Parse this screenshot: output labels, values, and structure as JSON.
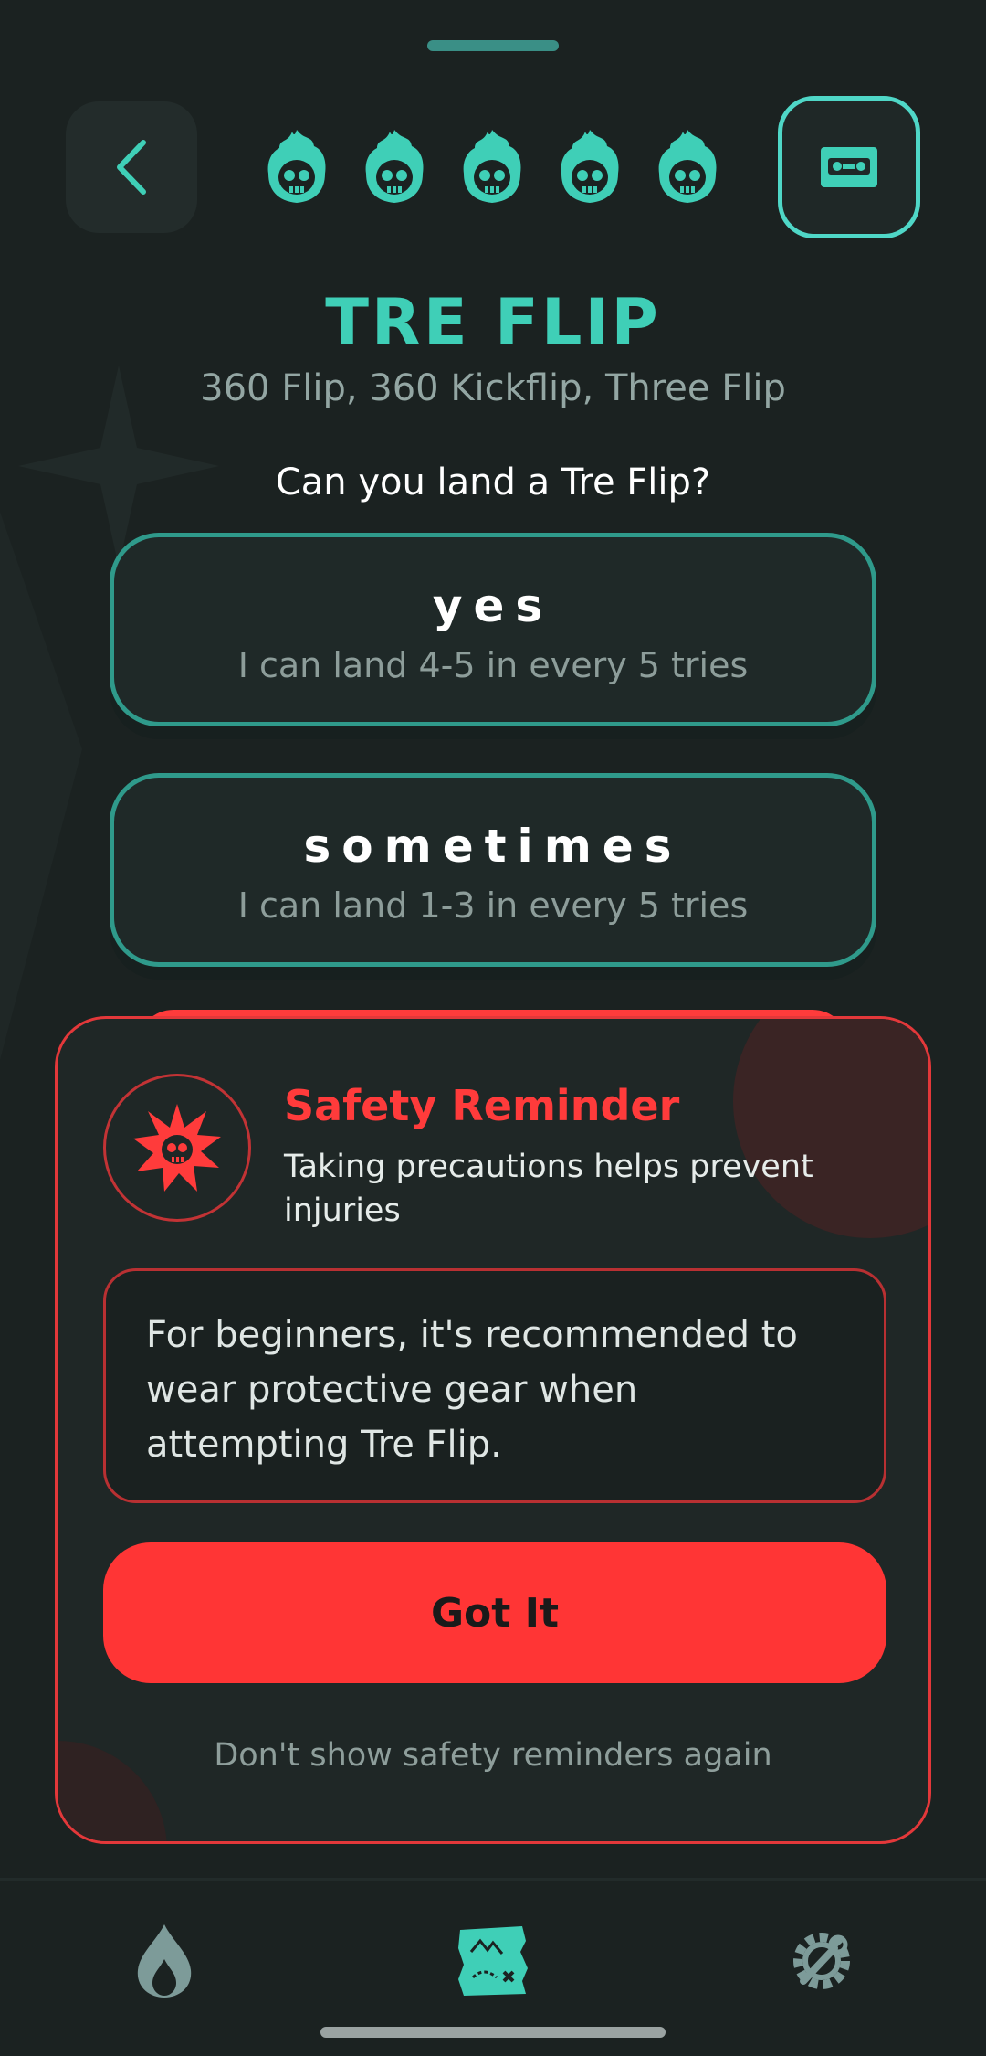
{
  "header": {
    "back_icon": "chevron-left-icon",
    "difficulty_icons": [
      "flaming-skull-icon",
      "flaming-skull-icon",
      "flaming-skull-icon",
      "flaming-skull-icon",
      "flaming-skull-icon"
    ],
    "tape_icon": "vhs-tape-icon"
  },
  "trick": {
    "title": "TRE FLIP",
    "aliases": "360 Flip, 360 Kickflip, Three Flip",
    "question": "Can you land a Tre Flip?"
  },
  "options": [
    {
      "label": "yes",
      "sub": "I can land 4-5 in every 5 tries"
    },
    {
      "label": "sometimes",
      "sub": "I can land 1-3 in every 5 tries"
    }
  ],
  "modal": {
    "icon": "skull-burst-icon",
    "title": "Safety Reminder",
    "subtitle": "Taking precautions helps prevent injuries",
    "notice": "For beginners, it's recommended to wear protective gear when attempting Tre Flip.",
    "confirm_label": "Got It",
    "dismiss_label": "Don't show safety reminders again"
  },
  "tabbar": {
    "tabs": [
      {
        "icon": "flame-icon"
      },
      {
        "icon": "treasure-map-icon"
      },
      {
        "icon": "wrench-gear-icon"
      }
    ]
  },
  "colors": {
    "accent": "#3fcfb7",
    "danger": "#ff3b3b",
    "background": "#1b2221"
  }
}
